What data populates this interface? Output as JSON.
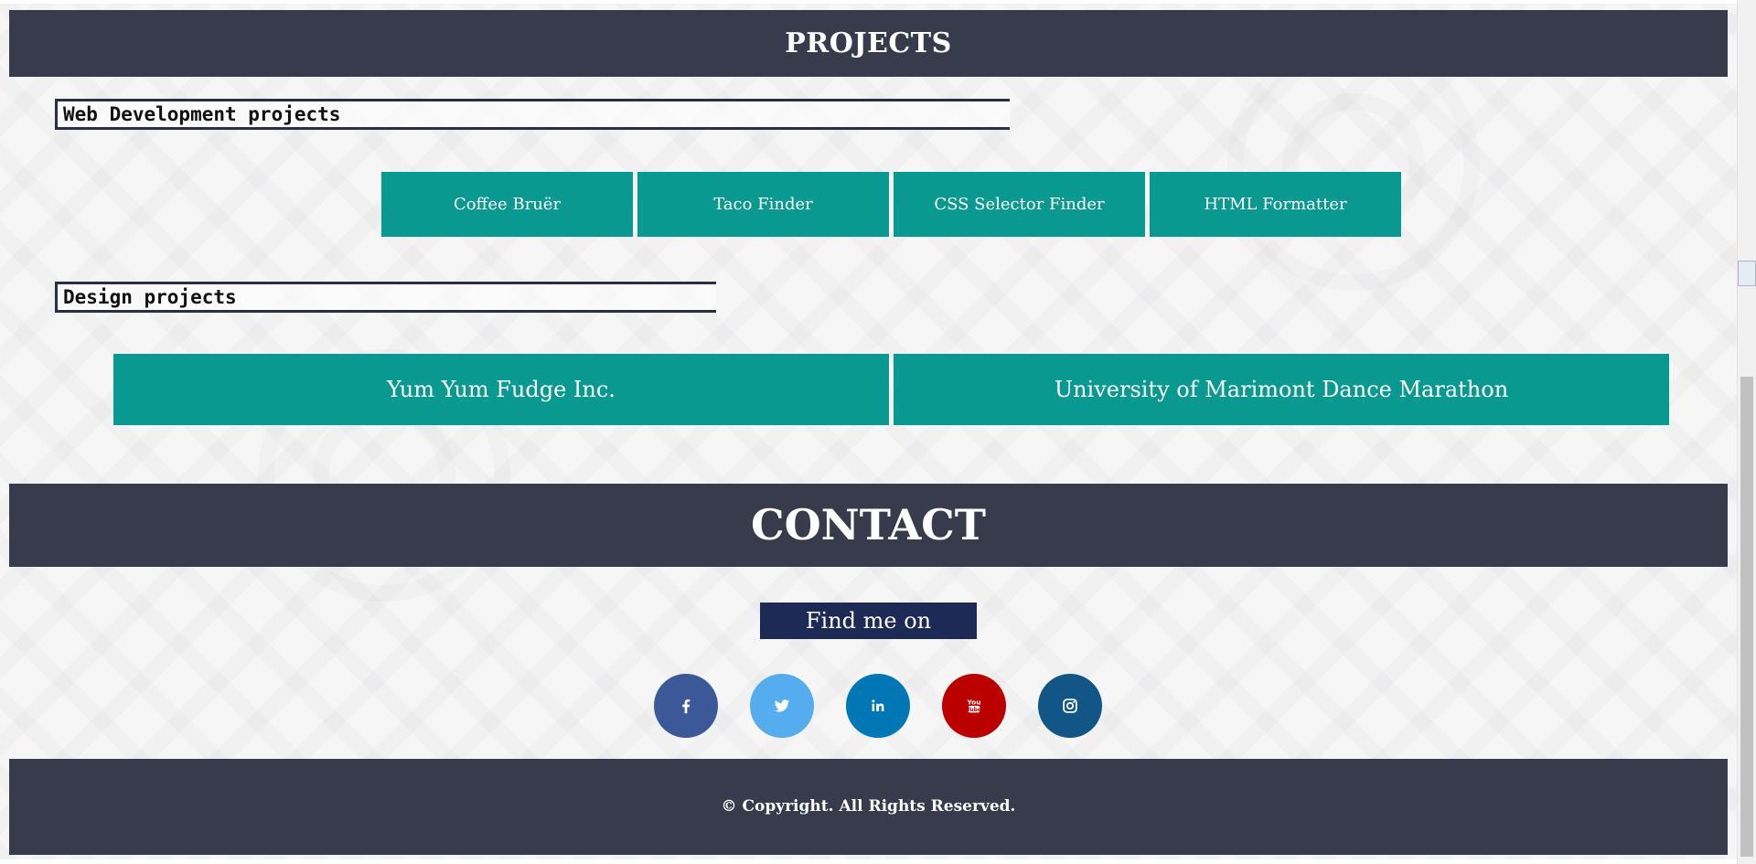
{
  "projects": {
    "title": "PROJECTS",
    "web_heading": "Web Development projects",
    "web_items": [
      {
        "label": "Coffee Bruër"
      },
      {
        "label": "Taco Finder"
      },
      {
        "label": "CSS Selector Finder"
      },
      {
        "label": "HTML Formatter"
      }
    ],
    "design_heading": "Design projects",
    "design_items": [
      {
        "label": "Yum Yum Fudge Inc."
      },
      {
        "label": "University of Marimont Dance Marathon"
      }
    ]
  },
  "contact": {
    "title": "CONTACT",
    "find_label": "Find me on",
    "socials": [
      {
        "name": "facebook",
        "icon": "facebook-icon",
        "color": "#3b5998"
      },
      {
        "name": "twitter",
        "icon": "twitter-icon",
        "color": "#55acee"
      },
      {
        "name": "linkedin",
        "icon": "linkedin-icon",
        "color": "#0077b5"
      },
      {
        "name": "youtube",
        "icon": "youtube-icon",
        "color": "#bb0000"
      },
      {
        "name": "instagram",
        "icon": "instagram-icon",
        "color": "#125688"
      }
    ]
  },
  "footer": {
    "copyright": "© Copyright. All Rights Reserved."
  },
  "colors": {
    "band": "#373b4b",
    "tile": "#0a9990",
    "findme": "#1c2a55"
  }
}
